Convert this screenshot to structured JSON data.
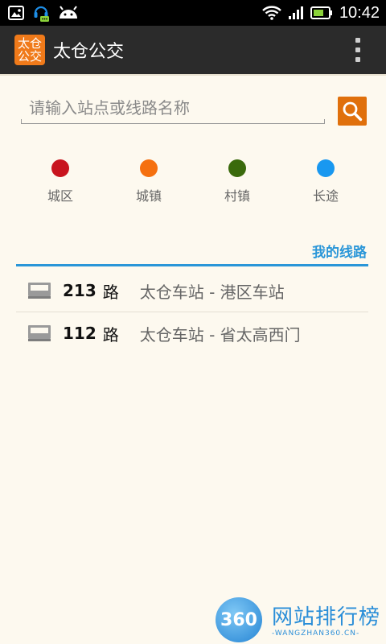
{
  "status_bar": {
    "time": "10:42",
    "icons": [
      "image-icon",
      "headset-notification-icon",
      "android-icon",
      "wifi-icon",
      "signal-icon",
      "battery-icon"
    ]
  },
  "action_bar": {
    "app_icon_line1": "太仓",
    "app_icon_line2": "公交",
    "title": "太仓公交"
  },
  "search": {
    "placeholder": "请输入站点或线路名称",
    "value": ""
  },
  "categories": [
    {
      "label": "城区",
      "color": "#c8141e"
    },
    {
      "label": "城镇",
      "color": "#f5700f"
    },
    {
      "label": "村镇",
      "color": "#3a6a0c"
    },
    {
      "label": "长途",
      "color": "#1998f0"
    }
  ],
  "my_lines_tab": {
    "label": "我的线路"
  },
  "routes": [
    {
      "number": "213",
      "unit": "路",
      "stops": "太仓车站 - 港区车站"
    },
    {
      "number": "112",
      "unit": "路",
      "stops": "太仓车站 - 省太高西门"
    }
  ],
  "watermark": {
    "badge": "360",
    "text": "网站排行榜",
    "sub": "-WANGZHAN360.CN-"
  },
  "colors": {
    "accent": "#2a96d8",
    "search_button": "#e0700c",
    "action_bar": "#2b2b2b",
    "background": "#fdf9ef"
  }
}
